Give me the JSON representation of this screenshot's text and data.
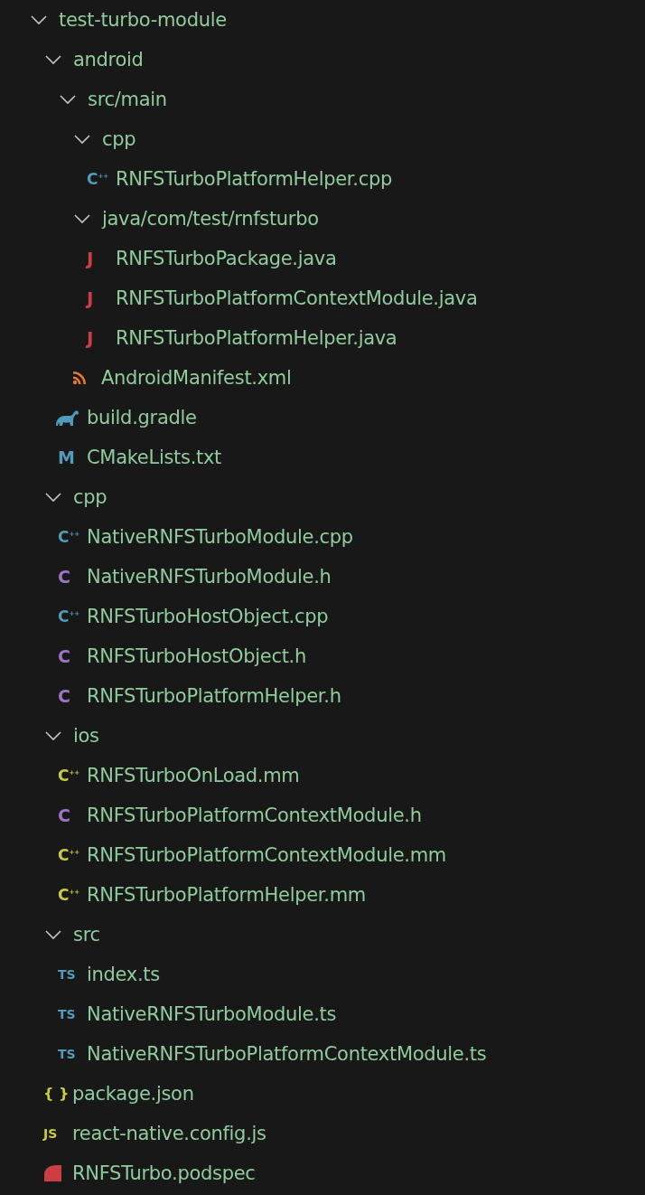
{
  "tree": [
    {
      "kind": "folder",
      "name": "test-turbo-module",
      "expanded": true,
      "children": [
        {
          "kind": "folder",
          "name": "android",
          "expanded": true,
          "children": [
            {
              "kind": "folder",
              "name": "src/main",
              "expanded": true,
              "children": [
                {
                  "kind": "folder",
                  "name": "cpp",
                  "expanded": true,
                  "children": [
                    {
                      "kind": "file",
                      "name": "RNFSTurboPlatformHelper.cpp",
                      "icon": {
                        "kind": "cpp",
                        "glyph": "C",
                        "mark": "++"
                      }
                    }
                  ]
                },
                {
                  "kind": "folder",
                  "name": "java/com/test/rnfsturbo",
                  "expanded": true,
                  "children": [
                    {
                      "kind": "file",
                      "name": "RNFSTurboPackage.java",
                      "icon": {
                        "kind": "java",
                        "glyph": "J"
                      }
                    },
                    {
                      "kind": "file",
                      "name": "RNFSTurboPlatformContextModule.java",
                      "icon": {
                        "kind": "java",
                        "glyph": "J"
                      }
                    },
                    {
                      "kind": "file",
                      "name": "RNFSTurboPlatformHelper.java",
                      "icon": {
                        "kind": "java",
                        "glyph": "J"
                      }
                    }
                  ]
                },
                {
                  "kind": "file",
                  "name": "AndroidManifest.xml",
                  "icon": {
                    "kind": "xml"
                  }
                }
              ]
            },
            {
              "kind": "file",
              "name": "build.gradle",
              "icon": {
                "kind": "gradle"
              }
            },
            {
              "kind": "file",
              "name": "CMakeLists.txt",
              "icon": {
                "kind": "cmake",
                "glyph": "M"
              }
            }
          ]
        },
        {
          "kind": "folder",
          "name": "cpp",
          "expanded": true,
          "children": [
            {
              "kind": "file",
              "name": "NativeRNFSTurboModule.cpp",
              "icon": {
                "kind": "cpp",
                "glyph": "C",
                "mark": "++"
              }
            },
            {
              "kind": "file",
              "name": "NativeRNFSTurboModule.h",
              "icon": {
                "kind": "h",
                "glyph": "C"
              }
            },
            {
              "kind": "file",
              "name": "RNFSTurboHostObject.cpp",
              "icon": {
                "kind": "cpp",
                "glyph": "C",
                "mark": "++"
              }
            },
            {
              "kind": "file",
              "name": "RNFSTurboHostObject.h",
              "icon": {
                "kind": "h",
                "glyph": "C"
              }
            },
            {
              "kind": "file",
              "name": "RNFSTurboPlatformHelper.h",
              "icon": {
                "kind": "h",
                "glyph": "C"
              }
            }
          ]
        },
        {
          "kind": "folder",
          "name": "ios",
          "expanded": true,
          "children": [
            {
              "kind": "file",
              "name": "RNFSTurboOnLoad.mm",
              "icon": {
                "kind": "mm",
                "glyph": "C",
                "mark": "++"
              }
            },
            {
              "kind": "file",
              "name": "RNFSTurboPlatformContextModule.h",
              "icon": {
                "kind": "h",
                "glyph": "C"
              }
            },
            {
              "kind": "file",
              "name": "RNFSTurboPlatformContextModule.mm",
              "icon": {
                "kind": "mm",
                "glyph": "C",
                "mark": "++"
              }
            },
            {
              "kind": "file",
              "name": "RNFSTurboPlatformHelper.mm",
              "icon": {
                "kind": "mm",
                "glyph": "C",
                "mark": "++"
              }
            }
          ]
        },
        {
          "kind": "folder",
          "name": "src",
          "expanded": true,
          "children": [
            {
              "kind": "file",
              "name": "index.ts",
              "icon": {
                "kind": "ts",
                "glyph": "TS"
              }
            },
            {
              "kind": "file",
              "name": "NativeRNFSTurboModule.ts",
              "icon": {
                "kind": "ts",
                "glyph": "TS"
              }
            },
            {
              "kind": "file",
              "name": "NativeRNFSTurboPlatformContextModule.ts",
              "icon": {
                "kind": "ts",
                "glyph": "TS"
              }
            }
          ]
        },
        {
          "kind": "file",
          "name": "package.json",
          "icon": {
            "kind": "json",
            "glyph": "{ }"
          }
        },
        {
          "kind": "file",
          "name": "react-native.config.js",
          "icon": {
            "kind": "js",
            "glyph": "JS"
          }
        },
        {
          "kind": "file",
          "name": "RNFSTurbo.podspec",
          "icon": {
            "kind": "podspec"
          }
        }
      ]
    }
  ]
}
